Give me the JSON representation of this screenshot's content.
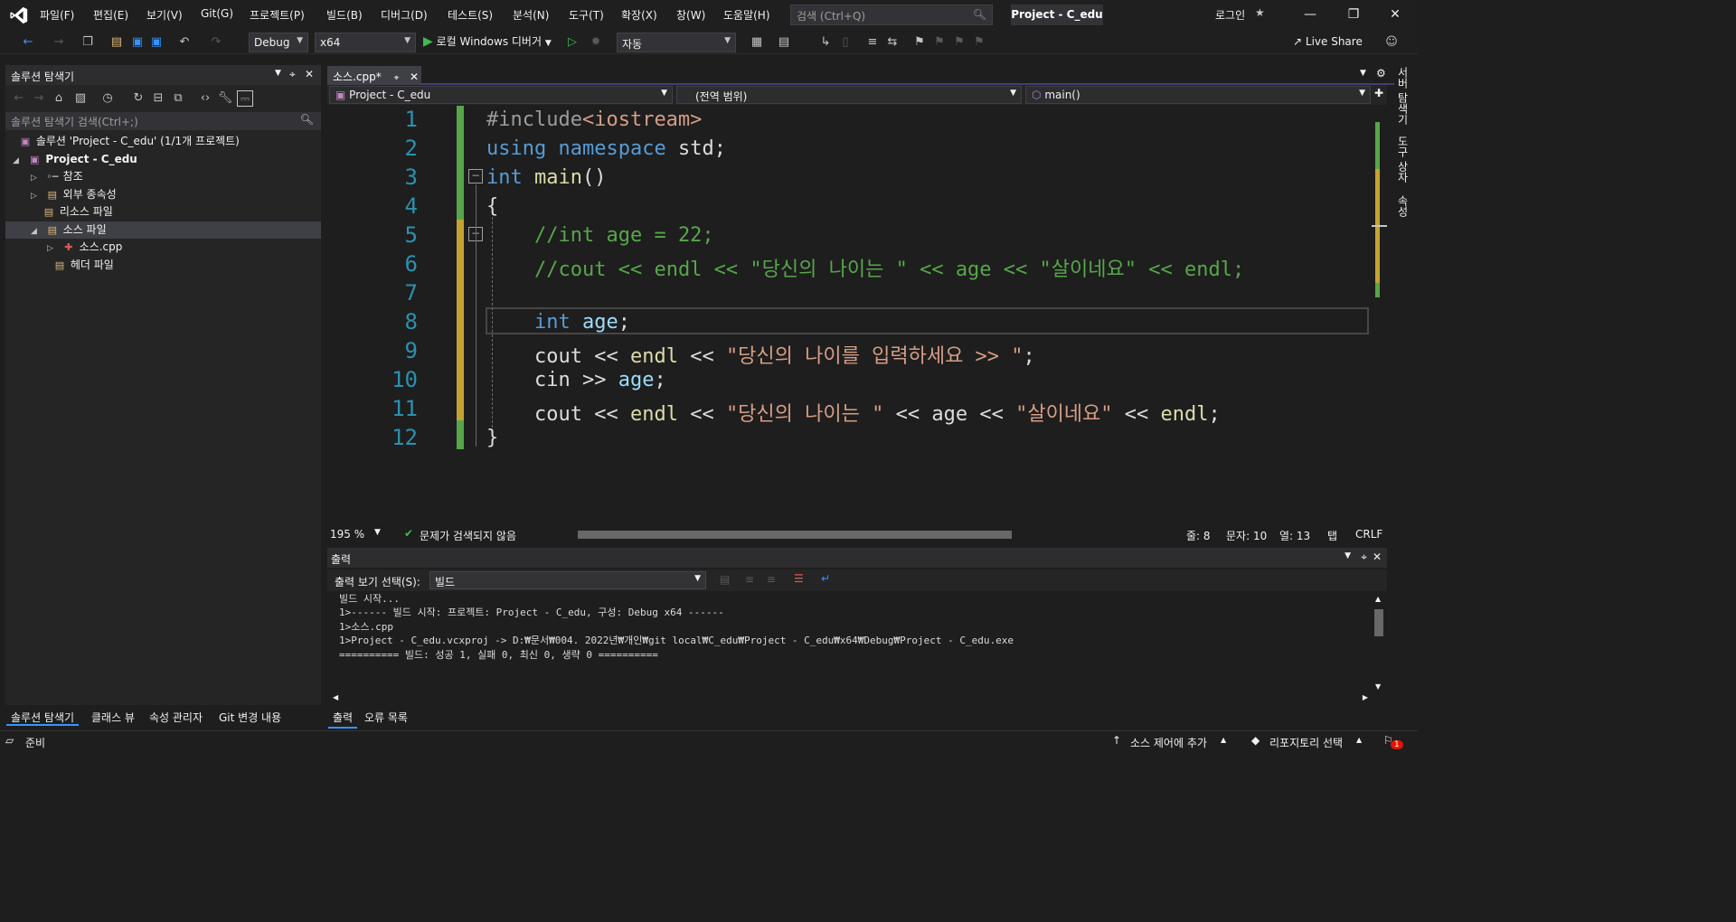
{
  "menu": [
    "파일(F)",
    "편집(E)",
    "보기(V)",
    "Git(G)",
    "프로젝트(P)",
    "빌드(B)",
    "디버그(D)",
    "테스트(S)",
    "분석(N)",
    "도구(T)",
    "확장(X)",
    "창(W)",
    "도움말(H)"
  ],
  "search": {
    "placeholder": "검색 (Ctrl+Q)"
  },
  "project_title": "Project - C_edu",
  "login": "로그인",
  "toolbar": {
    "config": "Debug",
    "platform": "x64",
    "run_label": "로컬 Windows 디버거",
    "auto": "자동",
    "live_share": "Live Share"
  },
  "solution_explorer": {
    "title": "솔루션 탐색기",
    "search": "솔루션 탐색기 검색(Ctrl+;)",
    "items": [
      {
        "label": "솔루션 'Project - C_edu' (1/1개 프로젝트)",
        "icon": "solution-icon"
      },
      {
        "label": "Project - C_edu",
        "icon": "project-icon"
      },
      {
        "label": "참조",
        "icon": "references-icon"
      },
      {
        "label": "외부 종속성",
        "icon": "external-deps-icon"
      },
      {
        "label": "리소스 파일",
        "icon": "folder-icon"
      },
      {
        "label": "소스 파일",
        "icon": "folder-open-icon"
      },
      {
        "label": "소스.cpp",
        "icon": "cpp-file-icon"
      },
      {
        "label": "헤더 파일",
        "icon": "folder-icon"
      }
    ],
    "tabs": [
      "솔루션 탐색기",
      "클래스 뷰",
      "속성 관리자",
      "Git 변경 내용"
    ]
  },
  "editor": {
    "tab": "소스.cpp*",
    "nav_project": "Project - C_edu",
    "nav_scope": "(전역 범위)",
    "nav_func": "main()",
    "line_numbers": [
      "1",
      "2",
      "3",
      "4",
      "5",
      "6",
      "7",
      "8",
      "9",
      "10",
      "11",
      "12"
    ],
    "code": {
      "l1a": "#include",
      "l1b": "<iostream>",
      "l2a": "using",
      "l2b": "namespace",
      "l2c": "std;",
      "l3a": "int",
      "l3b": "main",
      "l3c": "()",
      "l4": "{",
      "l5": "//int age = 22;",
      "l6": "//cout << endl << \"당신의 나이는 \" << age << \"살이네요\" << endl;",
      "l8a": "int",
      "l8b": "age",
      "l8c": ";",
      "l9a": "cout << ",
      "l9b": "endl",
      "l9c": " << ",
      "l9d": "\"당신의 나이를 입력하세요 >> \"",
      "l9e": ";",
      "l10a": "cin >> ",
      "l10b": "age",
      "l10c": ";",
      "l11a": "cout << ",
      "l11b": "endl",
      "l11c": " << ",
      "l11d": "\"당신의 나이는 \"",
      "l11e": " << ",
      "l11f": "age",
      "l11g": " << ",
      "l11h": "\"살이네요\"",
      "l11i": " << ",
      "l11j": "endl",
      "l11k": ";",
      "l12": "}"
    },
    "zoom": "195 %",
    "issues": "문제가 검색되지 않음",
    "line": "줄: 8",
    "char": "문자: 10",
    "col": "열: 13",
    "tab_mode": "탭",
    "eol": "CRLF"
  },
  "output": {
    "title": "출력",
    "source_label": "출력 보기 선택(S):",
    "source_value": "빌드",
    "lines": [
      "빌드 시작...",
      "1>------ 빌드 시작: 프로젝트: Project - C_edu, 구성: Debug x64 ------",
      "1>소스.cpp",
      "1>Project - C_edu.vcxproj -> D:₩문서₩004. 2022년₩개인₩git local₩C_edu₩Project - C_edu₩x64₩Debug₩Project - C_edu.exe",
      "========== 빌드: 성공 1, 실패 0, 최신 0, 생략 0 =========="
    ],
    "tabs": [
      "출력",
      "오류 목록"
    ]
  },
  "right_rail": [
    "서버 탐색기",
    "도구 상자",
    "속성"
  ],
  "status": {
    "ready": "준비",
    "source_control": "소스 제어에 추가",
    "repo": "리포지토리 선택",
    "notifications": "1"
  },
  "colors": {
    "accent": "#3794ff",
    "changed_saved": "#57a64a",
    "changed_unsaved": "#c5a332"
  }
}
